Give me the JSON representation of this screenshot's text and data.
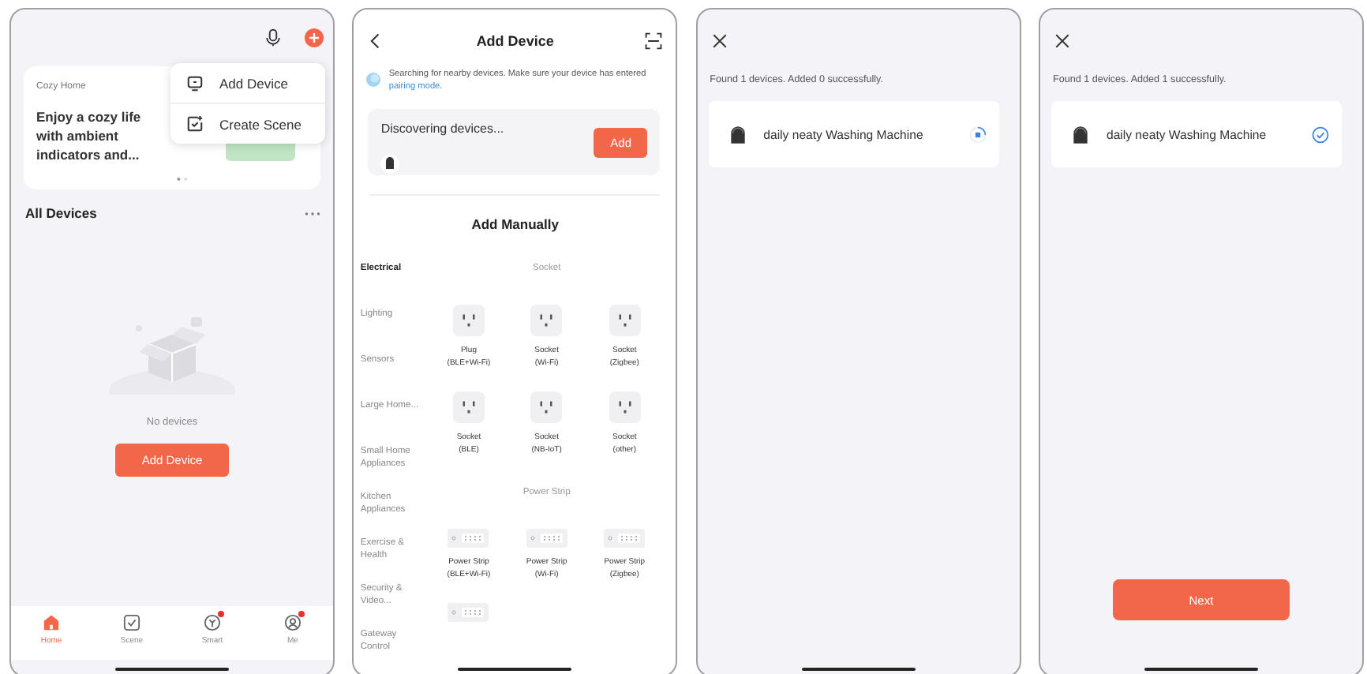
{
  "home": {
    "menu": [
      {
        "kind": "device",
        "label": "Add Device"
      },
      {
        "kind": "scene",
        "label": "Create Scene"
      }
    ],
    "banner": {
      "label": "Cozy Home",
      "text": "Enjoy a cozy life with ambient indicators and..."
    },
    "section_title": "All Devices",
    "empty_text": "No devices",
    "add_button": "Add Device",
    "tabs": [
      {
        "kind": "home",
        "label": "Home",
        "selected": true,
        "badge": false
      },
      {
        "kind": "scene",
        "label": "Scene",
        "selected": false,
        "badge": false
      },
      {
        "kind": "smart",
        "label": "Smart",
        "selected": false,
        "badge": true
      },
      {
        "kind": "me",
        "label": "Me",
        "selected": false,
        "badge": true
      }
    ]
  },
  "add_device": {
    "title": "Add Device",
    "notice": "Searching for nearby devices. Make sure your device has entered",
    "notice_link": "pairing mode",
    "notice_end": ".",
    "discovering": "Discovering devices...",
    "add_button": "Add",
    "manual_title": "Add Manually",
    "categories": [
      {
        "label": "Electrical",
        "selected": true
      },
      {
        "label": "Lighting",
        "selected": false
      },
      {
        "label": "Sensors",
        "selected": false
      },
      {
        "label": "Large Home...",
        "selected": false
      },
      {
        "label": "Small Home Appliances",
        "selected": false
      },
      {
        "label": "Kitchen Appliances",
        "selected": false
      },
      {
        "label": "Exercise & Health",
        "selected": false
      },
      {
        "label": "Security & Video...",
        "selected": false
      },
      {
        "label": "Gateway Control",
        "selected": false
      }
    ],
    "groups": [
      {
        "title": "Socket",
        "items": [
          {
            "kind": "socket",
            "name": "Plug",
            "variant": "(BLE+Wi-Fi)"
          },
          {
            "kind": "socket",
            "name": "Socket",
            "variant": "(Wi-Fi)"
          },
          {
            "kind": "socket",
            "name": "Socket",
            "variant": "(Zigbee)"
          },
          {
            "kind": "socket",
            "name": "Socket",
            "variant": "(BLE)"
          },
          {
            "kind": "socket",
            "name": "Socket",
            "variant": "(NB-IoT)"
          },
          {
            "kind": "socket",
            "name": "Socket",
            "variant": "(other)"
          }
        ]
      },
      {
        "title": "Power Strip",
        "items": [
          {
            "kind": "strip",
            "name": "Power Strip",
            "variant": "(BLE+Wi-Fi)"
          },
          {
            "kind": "strip",
            "name": "Power Strip",
            "variant": "(Wi-Fi)"
          },
          {
            "kind": "strip",
            "name": "Power Strip",
            "variant": "(Zigbee)"
          },
          {
            "kind": "strip"
          }
        ]
      }
    ]
  },
  "results": [
    {
      "summary": "Found 1 devices. Added 0 successfully.",
      "device": "daily neaty Washing Machine",
      "added": false
    },
    {
      "summary": "Found 1 devices. Added 1 successfully.",
      "device": "daily neaty Washing Machine",
      "added": true,
      "next_button": "Next"
    }
  ]
}
